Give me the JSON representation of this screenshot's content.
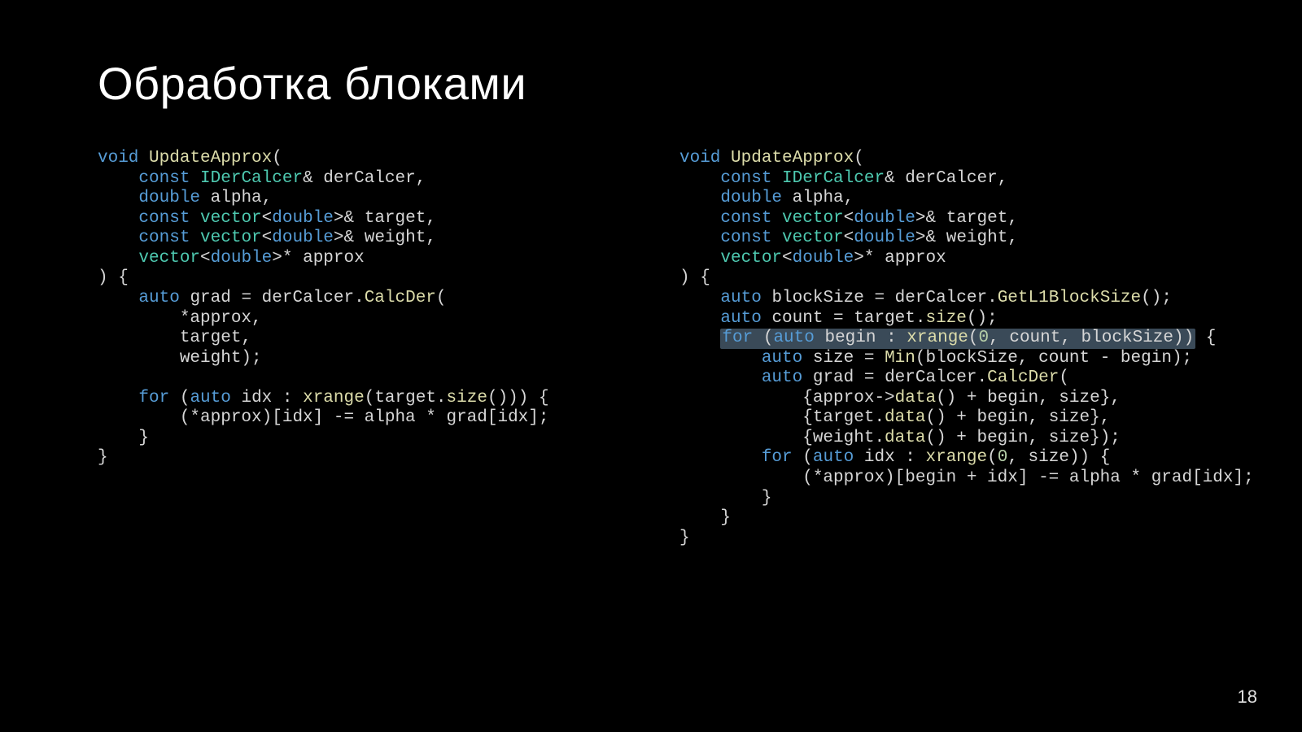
{
  "title": "Обработка блоками",
  "page_number": "18",
  "left_code_plain": "void UpdateApprox(\n    const IDerCalcer& derCalcer,\n    double alpha,\n    const vector<double>& target,\n    const vector<double>& weight,\n    vector<double>* approx\n) {\n    auto grad = derCalcer.CalcDer(\n        *approx,\n        target,\n        weight);\n\n    for (auto idx : xrange(target.size())) {\n        (*approx)[idx] -= alpha * grad[idx];\n    }\n}",
  "right_code_plain": "void UpdateApprox(\n    const IDerCalcer& derCalcer,\n    double alpha,\n    const vector<double>& target,\n    const vector<double>& weight,\n    vector<double>* approx\n) {\n    auto blockSize = derCalcer.GetL1BlockSize();\n    auto count = target.size();\n    for (auto begin : xrange(0, count, blockSize)) {\n        auto size = Min(blockSize, count - begin);\n        auto grad = derCalcer.CalcDer(\n            {approx->data() + begin, size},\n            {target.data() + begin, size},\n            {weight.data() + begin, size});\n        for (auto idx : xrange(0, size)) {\n            (*approx)[begin + idx] -= alpha * grad[idx];\n        }\n    }\n}",
  "highlighted_fragment_right": "for (auto begin : xrange(0, count, blockSize))"
}
